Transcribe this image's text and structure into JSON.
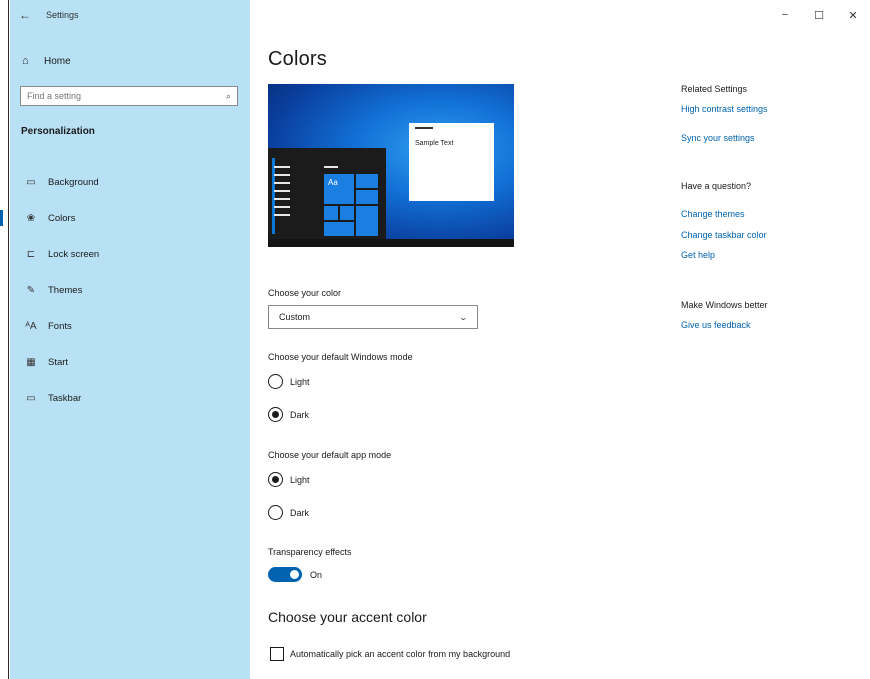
{
  "window": {
    "title": "Settings",
    "controls": {
      "minimize": "−",
      "maximize": "☐",
      "close": "✕"
    }
  },
  "sidebar": {
    "back_glyph": "←",
    "home_label": "Home",
    "search_placeholder": "Find a setting",
    "section_title": "Personalization",
    "items": [
      {
        "label": "Background",
        "icon": "picture-icon",
        "glyph": "▭"
      },
      {
        "label": "Colors",
        "icon": "palette-icon",
        "glyph": "❀",
        "active": true
      },
      {
        "label": "Lock screen",
        "icon": "lock-screen-icon",
        "glyph": "⊏"
      },
      {
        "label": "Themes",
        "icon": "themes-icon",
        "glyph": "✎"
      },
      {
        "label": "Fonts",
        "icon": "fonts-icon",
        "glyph": "ᴬA"
      },
      {
        "label": "Start",
        "icon": "start-icon",
        "glyph": "▦"
      },
      {
        "label": "Taskbar",
        "icon": "taskbar-icon",
        "glyph": "▭"
      }
    ]
  },
  "main": {
    "title": "Colors",
    "preview": {
      "sample_text": "Sample Text",
      "tile_text": "Aa"
    },
    "choose_color": {
      "label": "Choose your color",
      "value": "Custom"
    },
    "windows_mode": {
      "label": "Choose your default Windows mode",
      "options": [
        {
          "label": "Light",
          "selected": false
        },
        {
          "label": "Dark",
          "selected": true
        }
      ]
    },
    "app_mode": {
      "label": "Choose your default app mode",
      "options": [
        {
          "label": "Light",
          "selected": true
        },
        {
          "label": "Dark",
          "selected": false
        }
      ]
    },
    "transparency": {
      "label": "Transparency effects",
      "state": "On",
      "on": true
    },
    "accent": {
      "title": "Choose your accent color",
      "auto_pick_label": "Automatically pick an accent color from my background",
      "auto_pick_checked": false
    }
  },
  "related": {
    "related_settings_title": "Related Settings",
    "related_links": [
      "High contrast settings",
      "Sync your settings"
    ],
    "question_title": "Have a question?",
    "question_links": [
      "Change themes",
      "Change taskbar color",
      "Get help"
    ],
    "better_title": "Make Windows better",
    "better_links": [
      "Give us feedback"
    ]
  },
  "colors": {
    "sidebar_bg": "#b8e1f5",
    "accent": "#0063b1",
    "link": "#0063b1"
  }
}
